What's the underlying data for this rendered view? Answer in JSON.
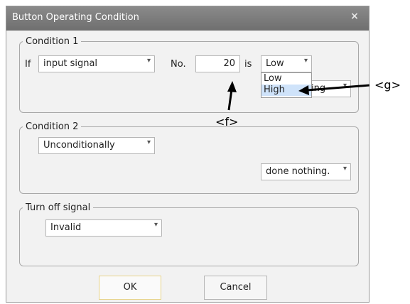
{
  "dialog": {
    "title": "Button Operating Condition",
    "close_glyph": "×"
  },
  "condition1": {
    "legend": "Condition 1",
    "if_label": "If",
    "signal_type": "input signal",
    "no_label": "No.",
    "number_value": "20",
    "is_label": "is",
    "level_value": "Low",
    "level_options": [
      "Low",
      "High"
    ],
    "level_highlighted": "High",
    "action_partial": "ing"
  },
  "condition2": {
    "legend": "Condition 2",
    "mode_value": "Unconditionally",
    "action_value": "done nothing."
  },
  "turn_off": {
    "legend": "Turn off signal",
    "value": "Invalid"
  },
  "buttons": {
    "ok": "OK",
    "cancel": "Cancel"
  },
  "annotations": {
    "f": "<f>",
    "g": "<g>"
  },
  "icons": {
    "dropdown_arrow": "▾"
  }
}
